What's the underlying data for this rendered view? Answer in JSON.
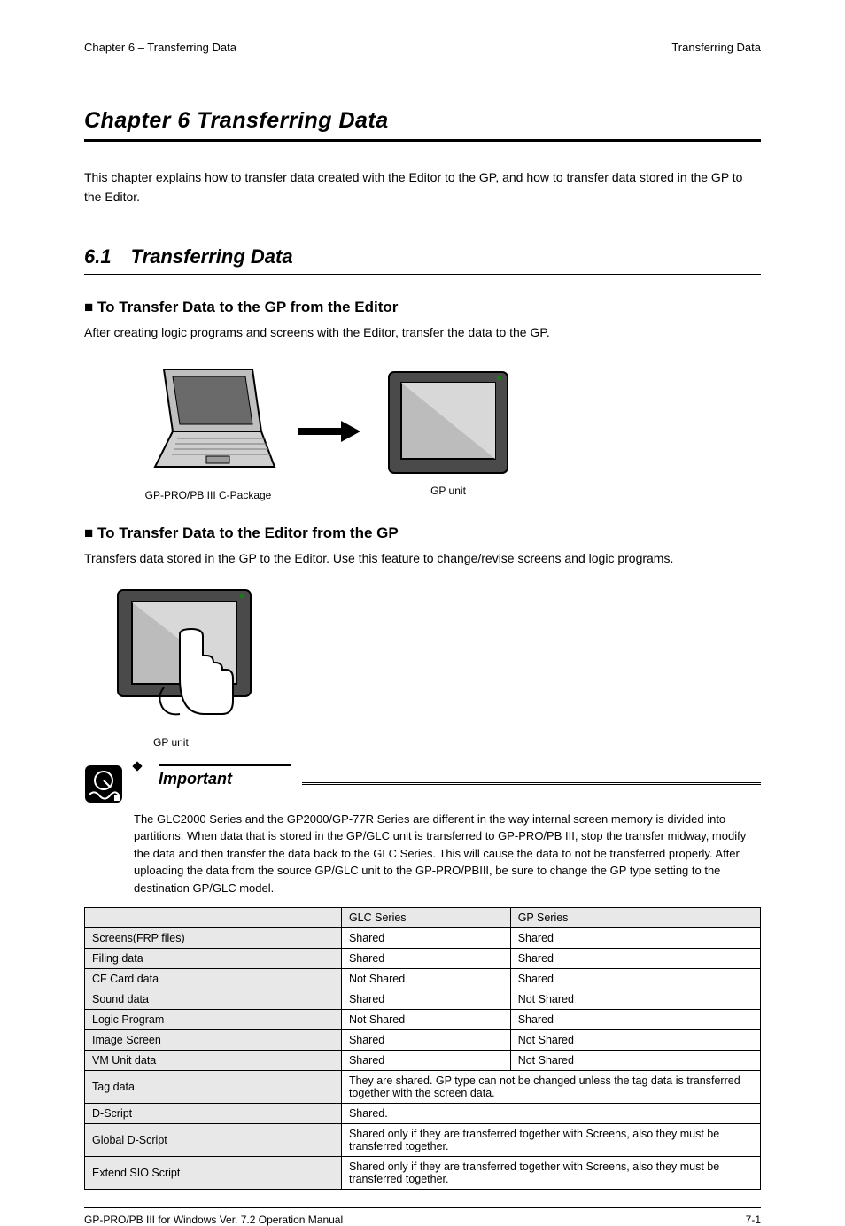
{
  "header": {
    "left": "Chapter 6 – Transferring Data",
    "right": "Transferring Data"
  },
  "chapter_title": "Chapter 6    Transferring Data",
  "intro_paragraph": "This chapter explains how to transfer data created with the Editor to the GP, and how to transfer data stored in the GP to the Editor.",
  "section": {
    "number": "6.1",
    "title": "Transferring Data"
  },
  "sub1": {
    "heading": "■ To Transfer Data to the GP from the Editor",
    "text": "After creating logic programs and screens with the Editor, transfer the data to the GP.",
    "laptop_label": "GP-PRO/PB III C-Package",
    "gp_label": "GP unit"
  },
  "sub2": {
    "heading": "■ To Transfer Data to the Editor from the GP",
    "text": "Transfers data stored in the GP to the Editor. Use this feature to change/revise screens and logic programs.",
    "gp_label": "GP unit"
  },
  "important": {
    "label": "Important",
    "text": "The GLC2000 Series and the GP2000/GP-77R Series are different in the way internal screen memory is divided into partitions. When data that is stored in the GP/GLC unit is transferred to GP-PRO/PB III, stop the transfer midway, modify the data and then transfer the data back to the GLC Series. This will cause the data to not be transferred properly. After uploading the data from the source GP/GLC unit to the GP-PRO/PBIII, be sure to change the GP type setting to the destination GP/GLC model."
  },
  "table": {
    "headers": [
      "",
      "GLC Series",
      "GP Series"
    ],
    "rows": [
      [
        "Screens(FRP files)",
        "Shared",
        "Shared"
      ],
      [
        "Filing data",
        "Shared",
        "Shared"
      ],
      [
        "CF Card data",
        "Not Shared",
        "Shared"
      ],
      [
        "Sound data",
        "Shared",
        "Not Shared"
      ],
      [
        "Logic Program",
        "Not Shared",
        "Shared"
      ],
      [
        "Image Screen",
        "Shared",
        "Not Shared"
      ],
      [
        "VM Unit data",
        "Shared",
        "Not Shared"
      ],
      [
        "Tag data",
        "They are shared. GP type can not be changed unless the tag data is transferred together with the screen data.",
        ""
      ],
      [
        "D-Script",
        "Shared.",
        ""
      ],
      [
        "Global D-Script",
        "Shared only if they are transferred together with Screens, also they must be transferred together.",
        ""
      ],
      [
        "Extend SIO Script",
        "Shared only if they are transferred together with Screens, also they must be transferred together.",
        ""
      ]
    ]
  },
  "footer": {
    "left": "GP-PRO/PB III for Windows Ver. 7.2 Operation Manual",
    "right": "7-1"
  }
}
